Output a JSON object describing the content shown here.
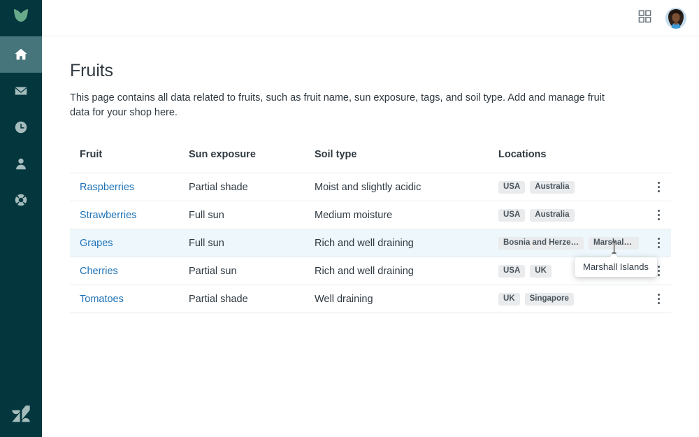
{
  "colors": {
    "sidebar_bg": "#03363D",
    "sidebar_active": "#46757C",
    "link": "#1f73b7",
    "text": "#2f3941",
    "tag_bg": "#e9ebed",
    "row_highlight": "#edf7fc",
    "border": "#e9ebed",
    "logo_green": "#68a98a"
  },
  "sidebar": {
    "brand_icon": "leaf-logo-icon",
    "items": [
      {
        "icon": "home-icon",
        "name": "home",
        "active": true
      },
      {
        "icon": "mail-icon",
        "name": "mail",
        "active": false
      },
      {
        "icon": "clock-icon",
        "name": "recent",
        "active": false
      },
      {
        "icon": "person-icon",
        "name": "customers",
        "active": false
      },
      {
        "icon": "lifebuoy-icon",
        "name": "support",
        "active": false
      }
    ],
    "footer_icon": "zendesk-logo-icon"
  },
  "topbar": {
    "grid_icon": "apps-grid-icon",
    "avatar_icon": "user-avatar"
  },
  "page": {
    "title": "Fruits",
    "description": "This page contains all data related to fruits, such as fruit name, sun exposure, tags, and soil type. Add and manage fruit data for your shop here."
  },
  "table": {
    "headers": [
      "Fruit",
      "Sun exposure",
      "Soil type",
      "Locations",
      ""
    ],
    "rows": [
      {
        "fruit": "Raspberries",
        "sun_exposure": "Partial shade",
        "soil_type": "Moist and slightly acidic",
        "locations": [
          "USA",
          "Australia"
        ],
        "highlighted": false
      },
      {
        "fruit": "Strawberries",
        "sun_exposure": "Full sun",
        "soil_type": "Medium moisture",
        "locations": [
          "USA",
          "Australia"
        ],
        "highlighted": false
      },
      {
        "fruit": "Grapes",
        "sun_exposure": "Full sun",
        "soil_type": "Rich and well draining",
        "locations": [
          "Bosnia and Herzegovina",
          "Marshall I..."
        ],
        "highlighted": true
      },
      {
        "fruit": "Cherries",
        "sun_exposure": "Partial sun",
        "soil_type": "Rich and well draining",
        "locations": [
          "USA",
          "UK"
        ],
        "highlighted": false
      },
      {
        "fruit": "Tomatoes",
        "sun_exposure": "Partial shade",
        "soil_type": "Well draining",
        "locations": [
          "UK",
          "Singapore"
        ],
        "highlighted": false
      }
    ],
    "row_menu_icon": "kebab-menu-icon"
  },
  "tooltip": {
    "text": "Marshall Islands"
  }
}
